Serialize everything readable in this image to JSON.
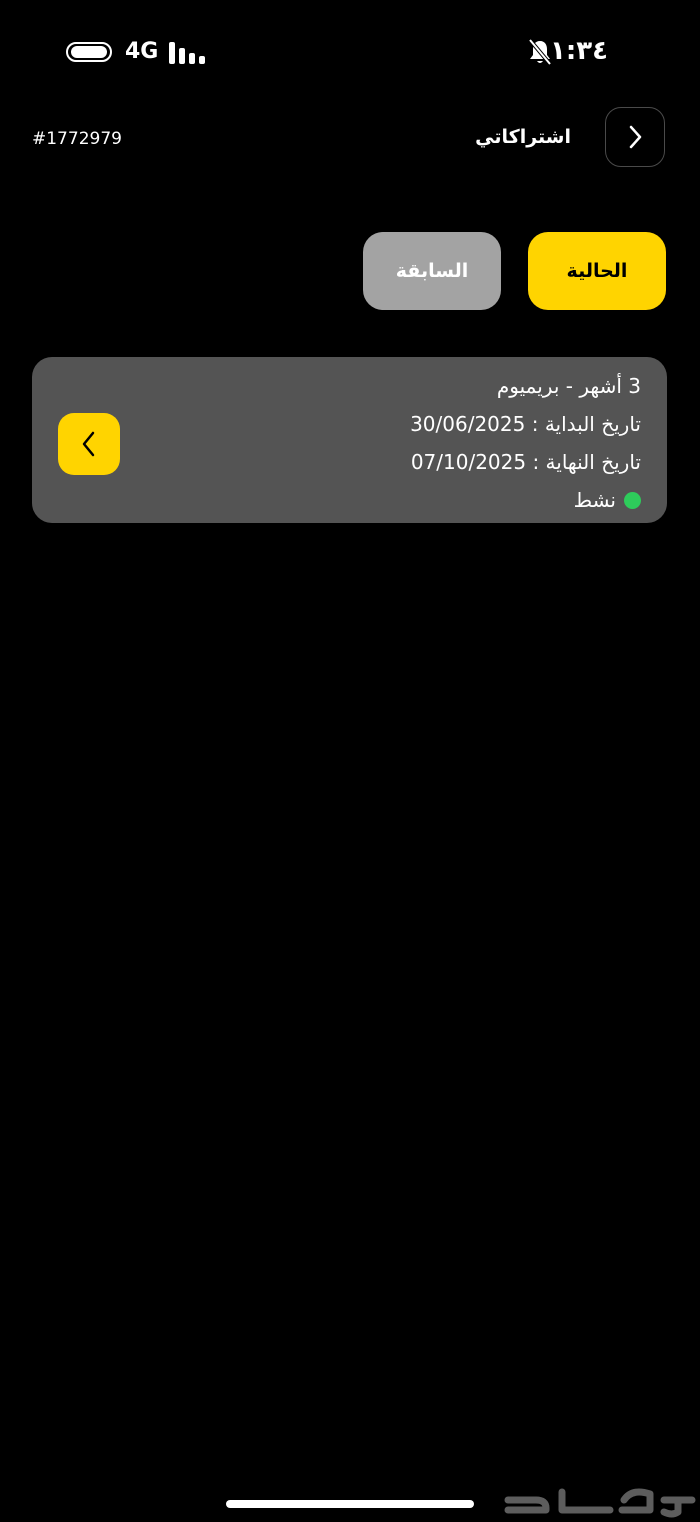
{
  "status_bar": {
    "time": "١:٣٤",
    "network": "4G",
    "icons": [
      "battery-icon",
      "signal-icon",
      "bell-muted-icon"
    ]
  },
  "header": {
    "title": "اشتراكاتي",
    "order_number": "#1772979",
    "back_icon": "chevron-right-icon"
  },
  "tabs": [
    {
      "label": "الحالية",
      "active": true
    },
    {
      "label": "السابقة",
      "active": false
    }
  ],
  "subscription": {
    "plan": "3 أشهر - بريميوم",
    "start_date": "تاريخ البداية : 30/06/2025",
    "end_date": "تاريخ النهاية : 07/10/2025",
    "status": "نشط",
    "status_color": "#2ecc5b",
    "action_icon": "chevron-left-icon"
  },
  "colors": {
    "accent": "#ffd400",
    "card_bg": "#545454",
    "inactive_tab": "#a3a3a3",
    "background": "#000000"
  },
  "watermark": {
    "text": "حراج"
  }
}
